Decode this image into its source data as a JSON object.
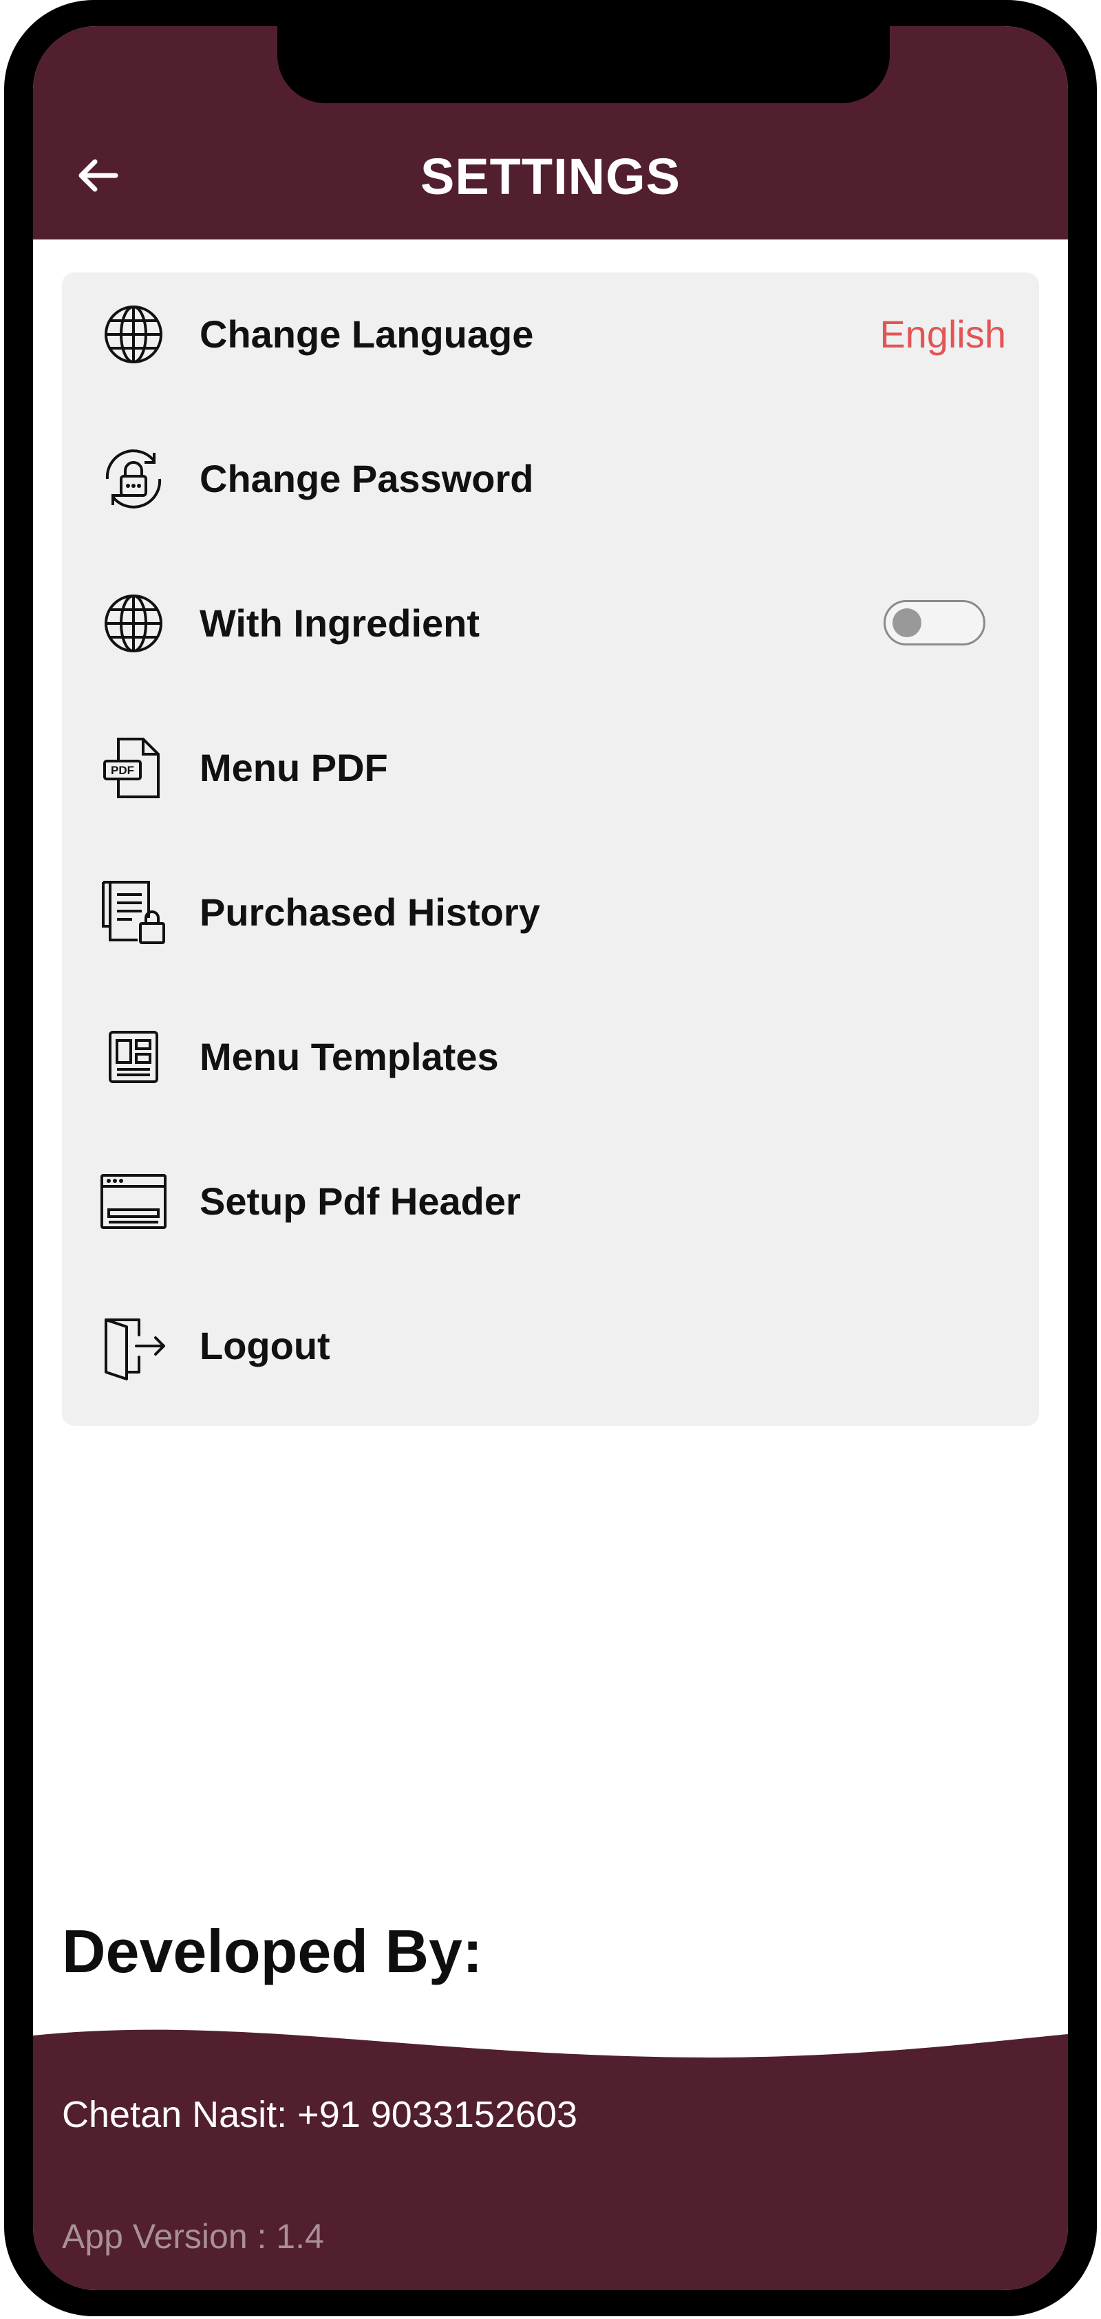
{
  "colors": {
    "brand": "#521f2e",
    "card_bg": "#f0f0f0",
    "accent_value": "#e25556",
    "text": "#111111"
  },
  "appbar": {
    "back_icon": "arrow-left-icon",
    "title": "SETTINGS"
  },
  "settings": {
    "items": [
      {
        "label": "Change Language",
        "icon": "globe-icon",
        "value": "English"
      },
      {
        "label": "Change Password",
        "icon": "lock-refresh-icon"
      },
      {
        "label": "With Ingredient",
        "icon": "globe-icon",
        "toggle": false
      },
      {
        "label": "Menu PDF",
        "icon": "pdf-file-icon"
      },
      {
        "label": "Purchased History",
        "icon": "receipt-bag-icon"
      },
      {
        "label": "Menu Templates",
        "icon": "template-layout-icon"
      },
      {
        "label": "Setup Pdf Header",
        "icon": "browser-window-icon"
      },
      {
        "label": "Logout",
        "icon": "logout-door-icon"
      }
    ]
  },
  "footer": {
    "heading": "Developed By:",
    "contact": "Chetan Nasit: +91 9033152603",
    "version": "App Version :  1.4"
  }
}
